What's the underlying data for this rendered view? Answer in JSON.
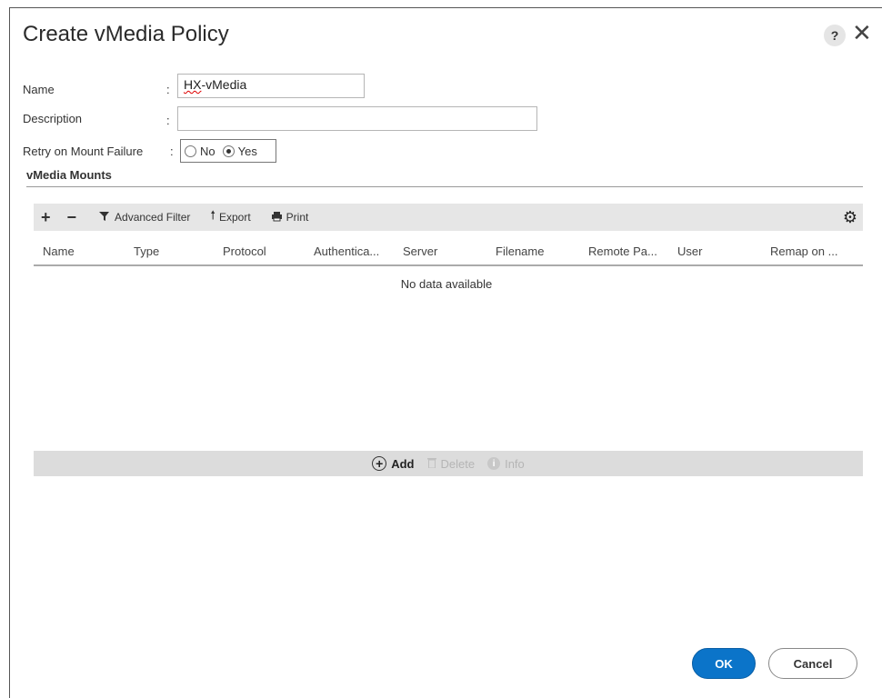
{
  "dialog": {
    "title": "Create vMedia Policy",
    "help_glyph": "?",
    "close_glyph": "✕"
  },
  "form": {
    "name_label": "Name",
    "name_value_prefix": "HX",
    "name_value_suffix": "-vMedia",
    "description_label": "Description",
    "description_value": "",
    "retry_label": "Retry on Mount Failure",
    "colon": ":",
    "retry_options": [
      {
        "label": "No",
        "selected": false
      },
      {
        "label": "Yes",
        "selected": true
      }
    ]
  },
  "mounts": {
    "section_title": "vMedia Mounts",
    "toolbar": {
      "plus": "+",
      "minus": "−",
      "advanced_filter": "Advanced Filter",
      "export": "Export",
      "print": "Print"
    },
    "columns": [
      "Name",
      "Type",
      "Protocol",
      "Authentica...",
      "Server",
      "Filename",
      "Remote Pa...",
      "User",
      "Remap on ..."
    ],
    "empty_text": "No data available",
    "actions": {
      "add": "Add",
      "delete": "Delete",
      "info": "Info"
    }
  },
  "footer": {
    "ok_label": "OK",
    "cancel_label": "Cancel"
  },
  "colors": {
    "primary": "#0b74c9",
    "toolbar_bg": "#e6e6e6",
    "actionbar_bg": "#dcdcdc"
  }
}
